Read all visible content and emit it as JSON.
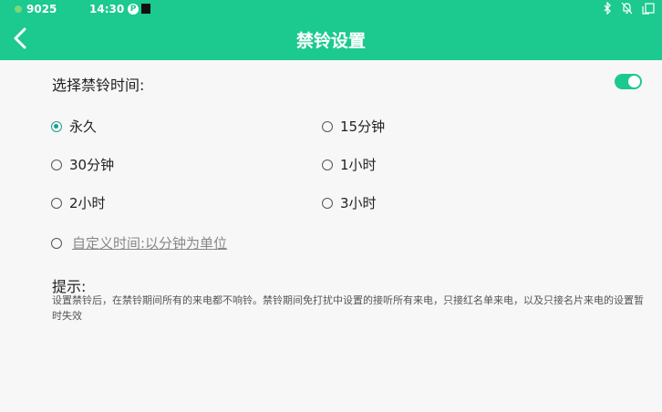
{
  "status_bar": {
    "signal": "9025",
    "time": "14:30",
    "p_icon_text": "P"
  },
  "header": {
    "title": "禁铃设置"
  },
  "section": {
    "label": "选择禁铃时间:",
    "toggle_on": true
  },
  "options": [
    {
      "label": "永久",
      "checked": true
    },
    {
      "label": "15分钟",
      "checked": false
    },
    {
      "label": "30分钟",
      "checked": false
    },
    {
      "label": "1小时",
      "checked": false
    },
    {
      "label": "2小时",
      "checked": false
    },
    {
      "label": "3小时",
      "checked": false
    }
  ],
  "custom_option": {
    "label": "自定义时间:以分钟为单位",
    "checked": false
  },
  "hint": {
    "title": "提示:",
    "body": "设置禁铃后，在禁铃期间所有的来电都不响铃。禁铃期间免打扰中设置的接听所有来电，只接红名单来电，以及只接名片来电的设置暂时失效"
  },
  "colors": {
    "header": "#1cc98f",
    "accent": "#1aa190",
    "background": "#f7f7f7"
  }
}
